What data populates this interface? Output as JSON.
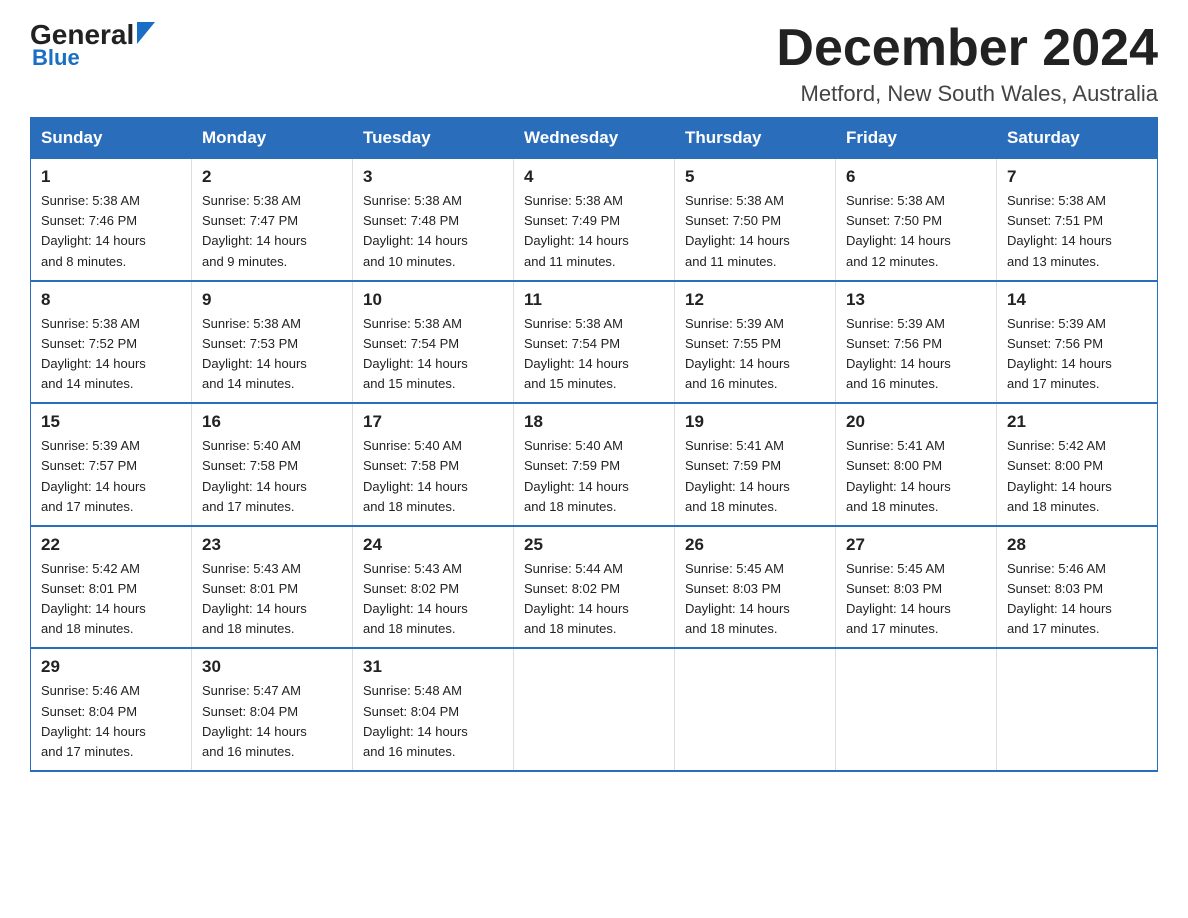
{
  "header": {
    "logo_top": "General",
    "logo_bottom": "Blue",
    "month_title": "December 2024",
    "location": "Metford, New South Wales, Australia"
  },
  "days_of_week": [
    "Sunday",
    "Monday",
    "Tuesday",
    "Wednesday",
    "Thursday",
    "Friday",
    "Saturday"
  ],
  "weeks": [
    [
      {
        "num": "1",
        "sunrise": "5:38 AM",
        "sunset": "7:46 PM",
        "daylight": "14 hours and 8 minutes."
      },
      {
        "num": "2",
        "sunrise": "5:38 AM",
        "sunset": "7:47 PM",
        "daylight": "14 hours and 9 minutes."
      },
      {
        "num": "3",
        "sunrise": "5:38 AM",
        "sunset": "7:48 PM",
        "daylight": "14 hours and 10 minutes."
      },
      {
        "num": "4",
        "sunrise": "5:38 AM",
        "sunset": "7:49 PM",
        "daylight": "14 hours and 11 minutes."
      },
      {
        "num": "5",
        "sunrise": "5:38 AM",
        "sunset": "7:50 PM",
        "daylight": "14 hours and 11 minutes."
      },
      {
        "num": "6",
        "sunrise": "5:38 AM",
        "sunset": "7:50 PM",
        "daylight": "14 hours and 12 minutes."
      },
      {
        "num": "7",
        "sunrise": "5:38 AM",
        "sunset": "7:51 PM",
        "daylight": "14 hours and 13 minutes."
      }
    ],
    [
      {
        "num": "8",
        "sunrise": "5:38 AM",
        "sunset": "7:52 PM",
        "daylight": "14 hours and 14 minutes."
      },
      {
        "num": "9",
        "sunrise": "5:38 AM",
        "sunset": "7:53 PM",
        "daylight": "14 hours and 14 minutes."
      },
      {
        "num": "10",
        "sunrise": "5:38 AM",
        "sunset": "7:54 PM",
        "daylight": "14 hours and 15 minutes."
      },
      {
        "num": "11",
        "sunrise": "5:38 AM",
        "sunset": "7:54 PM",
        "daylight": "14 hours and 15 minutes."
      },
      {
        "num": "12",
        "sunrise": "5:39 AM",
        "sunset": "7:55 PM",
        "daylight": "14 hours and 16 minutes."
      },
      {
        "num": "13",
        "sunrise": "5:39 AM",
        "sunset": "7:56 PM",
        "daylight": "14 hours and 16 minutes."
      },
      {
        "num": "14",
        "sunrise": "5:39 AM",
        "sunset": "7:56 PM",
        "daylight": "14 hours and 17 minutes."
      }
    ],
    [
      {
        "num": "15",
        "sunrise": "5:39 AM",
        "sunset": "7:57 PM",
        "daylight": "14 hours and 17 minutes."
      },
      {
        "num": "16",
        "sunrise": "5:40 AM",
        "sunset": "7:58 PM",
        "daylight": "14 hours and 17 minutes."
      },
      {
        "num": "17",
        "sunrise": "5:40 AM",
        "sunset": "7:58 PM",
        "daylight": "14 hours and 18 minutes."
      },
      {
        "num": "18",
        "sunrise": "5:40 AM",
        "sunset": "7:59 PM",
        "daylight": "14 hours and 18 minutes."
      },
      {
        "num": "19",
        "sunrise": "5:41 AM",
        "sunset": "7:59 PM",
        "daylight": "14 hours and 18 minutes."
      },
      {
        "num": "20",
        "sunrise": "5:41 AM",
        "sunset": "8:00 PM",
        "daylight": "14 hours and 18 minutes."
      },
      {
        "num": "21",
        "sunrise": "5:42 AM",
        "sunset": "8:00 PM",
        "daylight": "14 hours and 18 minutes."
      }
    ],
    [
      {
        "num": "22",
        "sunrise": "5:42 AM",
        "sunset": "8:01 PM",
        "daylight": "14 hours and 18 minutes."
      },
      {
        "num": "23",
        "sunrise": "5:43 AM",
        "sunset": "8:01 PM",
        "daylight": "14 hours and 18 minutes."
      },
      {
        "num": "24",
        "sunrise": "5:43 AM",
        "sunset": "8:02 PM",
        "daylight": "14 hours and 18 minutes."
      },
      {
        "num": "25",
        "sunrise": "5:44 AM",
        "sunset": "8:02 PM",
        "daylight": "14 hours and 18 minutes."
      },
      {
        "num": "26",
        "sunrise": "5:45 AM",
        "sunset": "8:03 PM",
        "daylight": "14 hours and 18 minutes."
      },
      {
        "num": "27",
        "sunrise": "5:45 AM",
        "sunset": "8:03 PM",
        "daylight": "14 hours and 17 minutes."
      },
      {
        "num": "28",
        "sunrise": "5:46 AM",
        "sunset": "8:03 PM",
        "daylight": "14 hours and 17 minutes."
      }
    ],
    [
      {
        "num": "29",
        "sunrise": "5:46 AM",
        "sunset": "8:04 PM",
        "daylight": "14 hours and 17 minutes."
      },
      {
        "num": "30",
        "sunrise": "5:47 AM",
        "sunset": "8:04 PM",
        "daylight": "14 hours and 16 minutes."
      },
      {
        "num": "31",
        "sunrise": "5:48 AM",
        "sunset": "8:04 PM",
        "daylight": "14 hours and 16 minutes."
      },
      null,
      null,
      null,
      null
    ]
  ],
  "labels": {
    "sunrise": "Sunrise:",
    "sunset": "Sunset:",
    "daylight": "Daylight:"
  }
}
